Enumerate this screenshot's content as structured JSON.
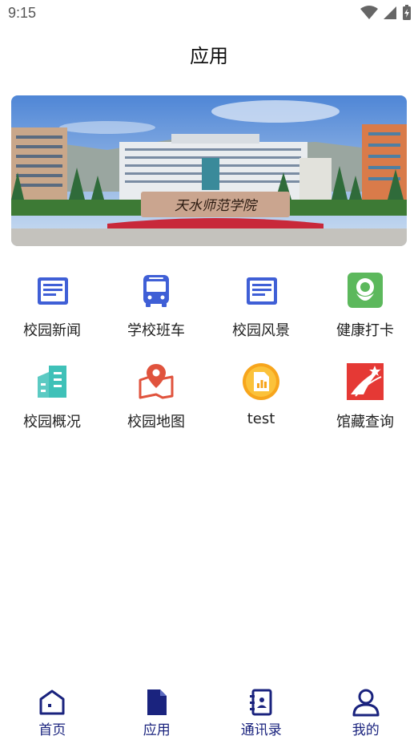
{
  "status": {
    "time": "9:15"
  },
  "header": {
    "title": "应用"
  },
  "banner": {
    "sign_text": "天水师范学院"
  },
  "apps": [
    {
      "label": "校园新闻",
      "icon": "news-icon"
    },
    {
      "label": "学校班车",
      "icon": "bus-icon"
    },
    {
      "label": "校园风景",
      "icon": "scenery-icon"
    },
    {
      "label": "健康打卡",
      "icon": "health-checkin-icon"
    },
    {
      "label": "校园概况",
      "icon": "campus-overview-icon"
    },
    {
      "label": "校园地图",
      "icon": "map-icon"
    },
    {
      "label": "test",
      "icon": "chart-icon"
    },
    {
      "label": "馆藏查询",
      "icon": "library-search-icon"
    }
  ],
  "tabs": [
    {
      "label": "首页",
      "icon": "home-icon"
    },
    {
      "label": "应用",
      "icon": "document-icon",
      "active": true
    },
    {
      "label": "通讯录",
      "icon": "contacts-icon"
    },
    {
      "label": "我的",
      "icon": "person-icon"
    }
  ],
  "colors": {
    "primary": "#3f5fd6",
    "tab": "#1a237e",
    "green": "#5cb85c",
    "teal": "#3fc1b8",
    "red": "#e53935",
    "orange": "#f7a51c"
  }
}
